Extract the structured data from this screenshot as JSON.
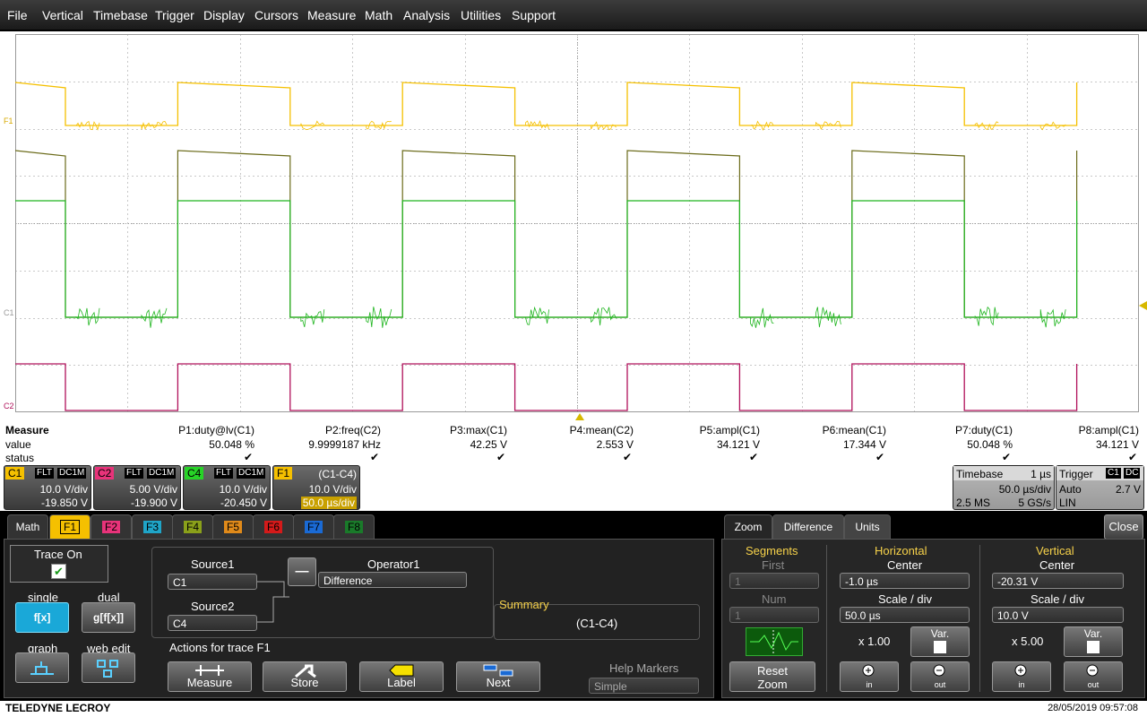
{
  "menu": [
    "File",
    "Vertical",
    "Timebase",
    "Trigger",
    "Display",
    "Cursors",
    "Measure",
    "Math",
    "Analysis",
    "Utilities",
    "Support"
  ],
  "markers": {
    "f1": "F1",
    "c1": "C1",
    "c2": "C2"
  },
  "measure": {
    "title": "Measure",
    "value_label": "value",
    "status_label": "status",
    "params": [
      {
        "name": "P1:duty@lv(C1)",
        "value": "50.048 %"
      },
      {
        "name": "P2:freq(C2)",
        "value": "9.9999187 kHz"
      },
      {
        "name": "P3:max(C1)",
        "value": "42.25 V"
      },
      {
        "name": "P4:mean(C2)",
        "value": "2.553 V"
      },
      {
        "name": "P5:ampl(C1)",
        "value": "34.121 V"
      },
      {
        "name": "P6:mean(C1)",
        "value": "17.344 V"
      },
      {
        "name": "P7:duty(C1)",
        "value": "50.048 %"
      },
      {
        "name": "P8:ampl(C1)",
        "value": "34.121 V"
      }
    ],
    "check": "✔"
  },
  "channels": [
    {
      "tag": "C1",
      "flt": "FLT",
      "cpl": "DC1M",
      "vdiv": "10.0 V/div",
      "offset": "-19.850 V",
      "color": "#f5c000"
    },
    {
      "tag": "C2",
      "flt": "FLT",
      "cpl": "DC1M",
      "vdiv": "5.00 V/div",
      "offset": "-19.900 V",
      "color": "#e8337a"
    },
    {
      "tag": "C4",
      "flt": "FLT",
      "cpl": "DC1M",
      "vdiv": "10.0 V/div",
      "offset": "-20.450 V",
      "color": "#27d327"
    }
  ],
  "f1desc": {
    "tag": "F1",
    "expr": "(C1-C4)",
    "vdiv": "10.0 V/div",
    "tdiv": "50.0 µs/div"
  },
  "timebase": {
    "label": "Timebase",
    "delay": "1 µs",
    "tdiv": "50.0 µs/div",
    "samples": "2.5 MS",
    "rate": "5 GS/s"
  },
  "trigger": {
    "label": "Trigger",
    "ch": "C1",
    "cpl": "DC",
    "mode": "Auto",
    "level": "2.7 V",
    "slope": "LIN"
  },
  "math_tabs": [
    "Math",
    "F1",
    "F2",
    "F3",
    "F4",
    "F5",
    "F6",
    "F7",
    "F8"
  ],
  "math": {
    "trace_on": "Trace On",
    "single": "single",
    "dual": "dual",
    "graph": "graph",
    "web_edit": "web edit",
    "single_icon": "f[x]",
    "dual_icon": "g[f[x]]",
    "source1_label": "Source1",
    "source1": "C1",
    "source2_label": "Source2",
    "source2": "C4",
    "operator_label": "Operator1",
    "operator": "Difference",
    "op_symbol": "—",
    "summary_label": "Summary",
    "summary": "(C1-C4)",
    "actions_label": "Actions for trace F1",
    "buttons": [
      "Measure",
      "Store",
      "Label",
      "Next"
    ],
    "help_label": "Help Markers",
    "help_value": "Simple"
  },
  "zoom": {
    "tabs": [
      "Zoom",
      "Difference",
      "Units"
    ],
    "close": "Close",
    "segments": "Segments",
    "first": "First",
    "first_val": "1",
    "num": "Num",
    "num_val": "1",
    "reset": "Reset",
    "zoom": "Zoom",
    "horizontal": "Horizontal",
    "h_center": "Center",
    "h_center_val": "-1.0 µs",
    "h_scale": "Scale / div",
    "h_scale_val": "50.0 µs",
    "h_mult": "x 1.00",
    "vertical": "Vertical",
    "v_center": "Center",
    "v_center_val": "-20.31 V",
    "v_scale": "Scale / div",
    "v_scale_val": "10.0 V",
    "v_mult": "x 5.00",
    "var": "Var.",
    "in": "in",
    "out": "out"
  },
  "footer": {
    "brand": "TELEDYNE LECROY",
    "datetime": "28/05/2019 09:57:08"
  }
}
